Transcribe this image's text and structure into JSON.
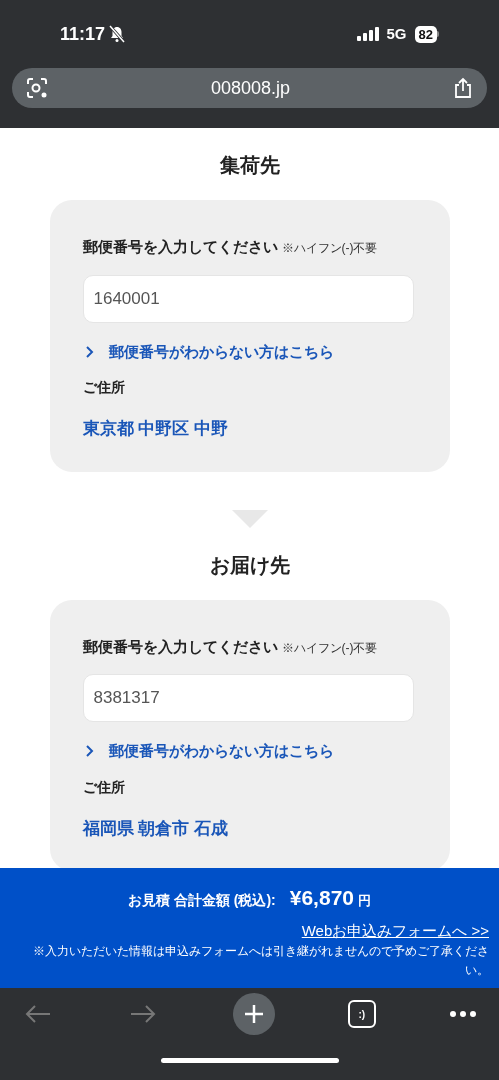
{
  "status_bar": {
    "time": "11:17",
    "network": "5G",
    "battery": "82"
  },
  "address_bar": {
    "url": "008008.jp"
  },
  "sections": [
    {
      "title": "集荷先",
      "label": "郵便番号を入力してください",
      "note": "※ハイフン(-)不要",
      "postal_code": "1640001",
      "help_link": "郵便番号がわからない方はこちら",
      "address_label": "ご住所",
      "address": "東京都 中野区 中野"
    },
    {
      "title": "お届け先",
      "label": "郵便番号を入力してください",
      "note": "※ハイフン(-)不要",
      "postal_code": "8381317",
      "help_link": "郵便番号がわからない方はこちら",
      "address_label": "ご住所",
      "address": "福岡県 朝倉市 石成"
    }
  ],
  "estimate": {
    "label": "お見積 合計金額 (税込):",
    "amount": "¥6,870",
    "unit": "円",
    "link": "Webお申込みフォームへ >>",
    "notice": "※入力いただいた情報は申込みフォームへは引き継がれませんので予めご了承ください。"
  },
  "toolbar": {
    "back_disabled": true,
    "forward_disabled": true,
    "tabs_label": ":)"
  }
}
